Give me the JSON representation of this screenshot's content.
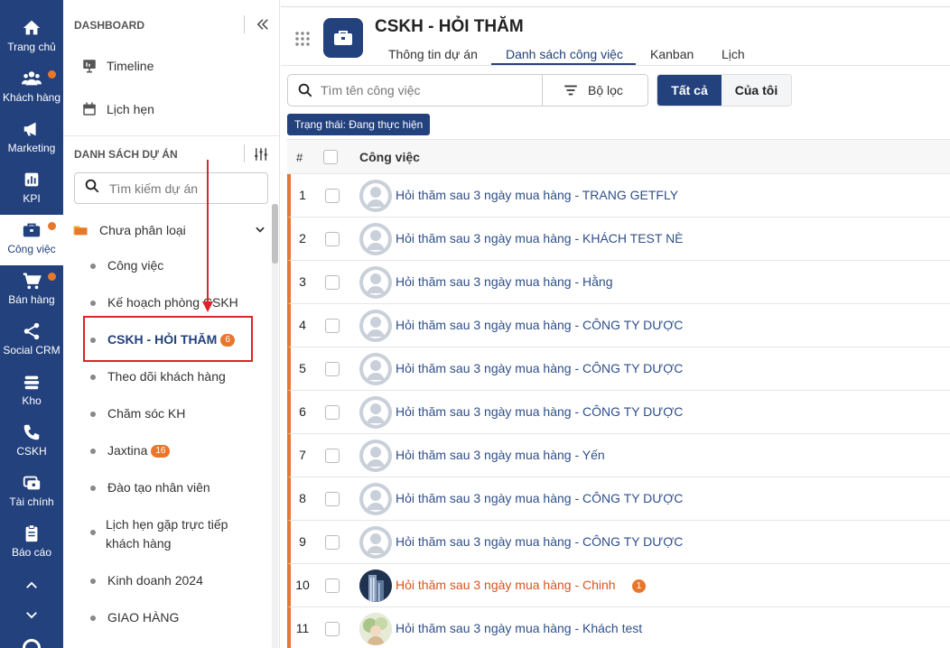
{
  "rail": {
    "items": [
      {
        "label": "Trang chủ",
        "icon": "home-icon",
        "dot": false,
        "active": false
      },
      {
        "label": "Khách hàng",
        "icon": "users-icon",
        "dot": true,
        "active": false
      },
      {
        "label": "Marketing",
        "icon": "megaphone-icon",
        "dot": false,
        "active": false
      },
      {
        "label": "KPI",
        "icon": "chart-icon",
        "dot": false,
        "active": false
      },
      {
        "label": "Công việc",
        "icon": "briefcase-icon",
        "dot": true,
        "active": true
      },
      {
        "label": "Bán hàng",
        "icon": "cart-icon",
        "dot": true,
        "active": false
      },
      {
        "label": "Social CRM",
        "icon": "share-icon",
        "dot": false,
        "active": false
      },
      {
        "label": "Kho",
        "icon": "warehouse-icon",
        "dot": false,
        "active": false
      },
      {
        "label": "CSKH",
        "icon": "phone-icon",
        "dot": false,
        "active": false
      },
      {
        "label": "Tài chính",
        "icon": "finance-icon",
        "dot": false,
        "active": false
      },
      {
        "label": "Báo cáo",
        "icon": "clipboard-icon",
        "dot": false,
        "active": false
      }
    ]
  },
  "panel": {
    "dashboard_title": "DASHBOARD",
    "timeline": "Timeline",
    "appointments": "Lịch hẹn",
    "projects_title": "DANH SÁCH DỰ ÁN",
    "search_placeholder": "Tìm kiếm dự án",
    "folder": "Chưa phân loại",
    "projects": [
      {
        "label": "Công việc",
        "badge": ""
      },
      {
        "label": "Kế hoạch phòng CSKH",
        "badge": ""
      },
      {
        "label": "CSKH - HỎI THĂM",
        "badge": "6",
        "active": true
      },
      {
        "label": "Theo dõi khách hàng",
        "badge": ""
      },
      {
        "label": "Chăm sóc KH",
        "badge": ""
      },
      {
        "label": "Jaxtina",
        "badge": "16"
      },
      {
        "label": "Đào tạo nhân viên",
        "badge": ""
      },
      {
        "label": "Lịch hẹn gặp trực tiếp khách hàng",
        "badge": ""
      },
      {
        "label": "Kinh doanh 2024",
        "badge": ""
      },
      {
        "label": "GIAO HÀNG",
        "badge": ""
      }
    ]
  },
  "header": {
    "title": "CSKH - HỎI THĂM",
    "tabs": [
      "Thông tin dự án",
      "Danh sách công việc",
      "Kanban",
      "Lịch"
    ],
    "active_tab": "Danh sách công việc"
  },
  "toolbar": {
    "search_placeholder": "Tìm tên công việc",
    "filter_label": "Bộ lọc",
    "seg_all": "Tất cả",
    "seg_mine": "Của tôi",
    "status_chip": "Trạng thái: Đang thực hiện"
  },
  "table": {
    "col_hash": "#",
    "col_task": "Công việc",
    "rows": [
      {
        "num": "1",
        "title": "Hỏi thăm sau 3 ngày mua hàng - TRANG GETFLY",
        "avatar": "default"
      },
      {
        "num": "2",
        "title": "Hỏi thăm sau 3 ngày mua hàng - KHÁCH TEST NÈ",
        "avatar": "default"
      },
      {
        "num": "3",
        "title": "Hỏi thăm sau 3 ngày mua hàng - Hằng",
        "avatar": "default"
      },
      {
        "num": "4",
        "title": "Hỏi thăm sau 3 ngày mua hàng - CÔNG TY DƯỢC",
        "avatar": "default"
      },
      {
        "num": "5",
        "title": "Hỏi thăm sau 3 ngày mua hàng - CÔNG TY DƯỢC",
        "avatar": "default"
      },
      {
        "num": "6",
        "title": "Hỏi thăm sau 3 ngày mua hàng - CÔNG TY DƯỢC",
        "avatar": "default"
      },
      {
        "num": "7",
        "title": "Hỏi thăm sau 3 ngày mua hàng - Yến",
        "avatar": "default"
      },
      {
        "num": "8",
        "title": "Hỏi thăm sau 3 ngày mua hàng - CÔNG TY DƯỢC",
        "avatar": "default"
      },
      {
        "num": "9",
        "title": "Hỏi thăm sau 3 ngày mua hàng - CÔNG TY DƯỢC",
        "avatar": "default"
      },
      {
        "num": "10",
        "title": "Hỏi thăm sau 3 ngày mua hàng - Chinh",
        "avatar": "building",
        "hot": true,
        "comments": "1"
      },
      {
        "num": "11",
        "title": "Hỏi thăm sau 3 ngày mua hàng - Khách test",
        "avatar": "photo"
      }
    ]
  },
  "colors": {
    "brand": "#22417d",
    "accent": "#e8772e",
    "alert": "#d9262a"
  }
}
